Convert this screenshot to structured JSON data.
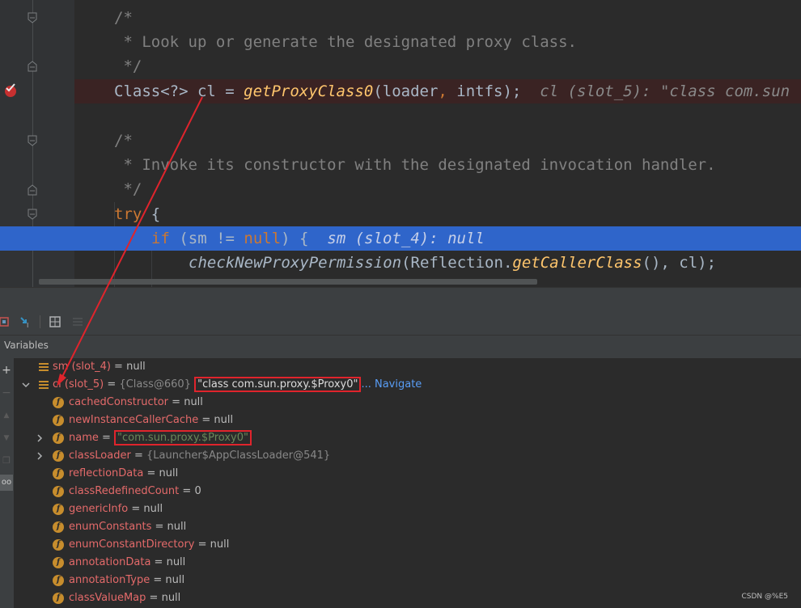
{
  "editor": {
    "lines": [
      {
        "type": "comment",
        "text": "/*"
      },
      {
        "type": "comment",
        "text": " * Look up or generate the designated proxy class."
      },
      {
        "type": "comment",
        "text": " */"
      },
      {
        "type": "code1",
        "pre": "Class<?> cl = ",
        "call": "getProxyClass0",
        "args1": "(loader",
        ",": ", ",
        "args2": "intfs);",
        "inline": "  cl (slot_5): \"class com.sun"
      },
      {
        "type": "blank",
        "text": ""
      },
      {
        "type": "comment",
        "text": "/*"
      },
      {
        "type": "comment",
        "text": " * Invoke its constructor with the designated invocation handler."
      },
      {
        "type": "comment",
        "text": " */"
      },
      {
        "type": "try",
        "kw": "try",
        "rest": " {"
      },
      {
        "type": "if",
        "kw": "if",
        "mid": " (sm != ",
        "null": "null",
        "end": ") {",
        "inline": "  sm (slot_4): null"
      },
      {
        "type": "check",
        "call": "checkNewProxyPermission",
        "open": "(Reflection.",
        "call2": "getCallerClass",
        "close": "(), cl);"
      }
    ]
  },
  "panel": {
    "vars_title": "Variables"
  },
  "variables": [
    {
      "name": "sm (slot_4)",
      "eq": " = ",
      "value": "null"
    },
    {
      "name": "cl (slot_5)",
      "eq": " = ",
      "ref": "{Class@660} ",
      "str": "\"class com.sun.proxy.$Proxy0\"",
      "link": "... Navigate"
    },
    {
      "name": "cachedConstructor",
      "eq": " = ",
      "value": "null"
    },
    {
      "name": "newInstanceCallerCache",
      "eq": " = ",
      "value": "null"
    },
    {
      "name": "name",
      "eq": " = ",
      "str": "\"com.sun.proxy.$Proxy0\""
    },
    {
      "name": "classLoader",
      "eq": " = ",
      "ref": "{Launcher$AppClassLoader@541}"
    },
    {
      "name": "reflectionData",
      "eq": " = ",
      "value": "null"
    },
    {
      "name": "classRedefinedCount",
      "eq": " = ",
      "value": "0"
    },
    {
      "name": "genericInfo",
      "eq": " = ",
      "value": "null"
    },
    {
      "name": "enumConstants",
      "eq": " = ",
      "value": "null"
    },
    {
      "name": "enumConstantDirectory",
      "eq": " = ",
      "value": "null"
    },
    {
      "name": "annotationData",
      "eq": " = ",
      "value": "null"
    },
    {
      "name": "annotationType",
      "eq": " = ",
      "value": "null"
    },
    {
      "name": "classValueMap",
      "eq": " = ",
      "value": "null"
    }
  ],
  "icons": {
    "field": "f",
    "local": "list-lines-icon",
    "breakpoint": "breakpoint-check-icon"
  },
  "colors": {
    "current_line": "#2f65ca",
    "breakpoint_line": "#3a2323",
    "annotation_red": "#e0242c"
  },
  "watermark": "CSDN @%E5"
}
